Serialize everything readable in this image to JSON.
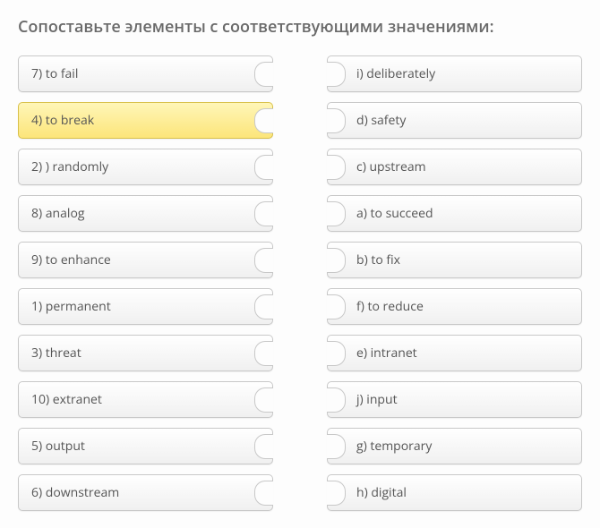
{
  "title": "Сопоставьте элементы с соответствующими значениями:",
  "left": [
    {
      "label": "7) to fail",
      "selected": false
    },
    {
      "label": "4) to break",
      "selected": true
    },
    {
      "label": "2) ) randomly",
      "selected": false
    },
    {
      "label": "8) analog",
      "selected": false
    },
    {
      "label": "9) to enhance",
      "selected": false
    },
    {
      "label": "1) permanent",
      "selected": false
    },
    {
      "label": "3) threat",
      "selected": false
    },
    {
      "label": "10) extranet",
      "selected": false
    },
    {
      "label": "5) output",
      "selected": false
    },
    {
      "label": "6) downstream",
      "selected": false
    }
  ],
  "right": [
    {
      "label": "i) deliberately"
    },
    {
      "label": "d) safety"
    },
    {
      "label": "c) upstream"
    },
    {
      "label": "a) to succeed"
    },
    {
      "label": "b) to fix"
    },
    {
      "label": "f) to reduce"
    },
    {
      "label": "e) intranet"
    },
    {
      "label": "j) input"
    },
    {
      "label": "g) temporary"
    },
    {
      "label": "h) digital"
    }
  ]
}
